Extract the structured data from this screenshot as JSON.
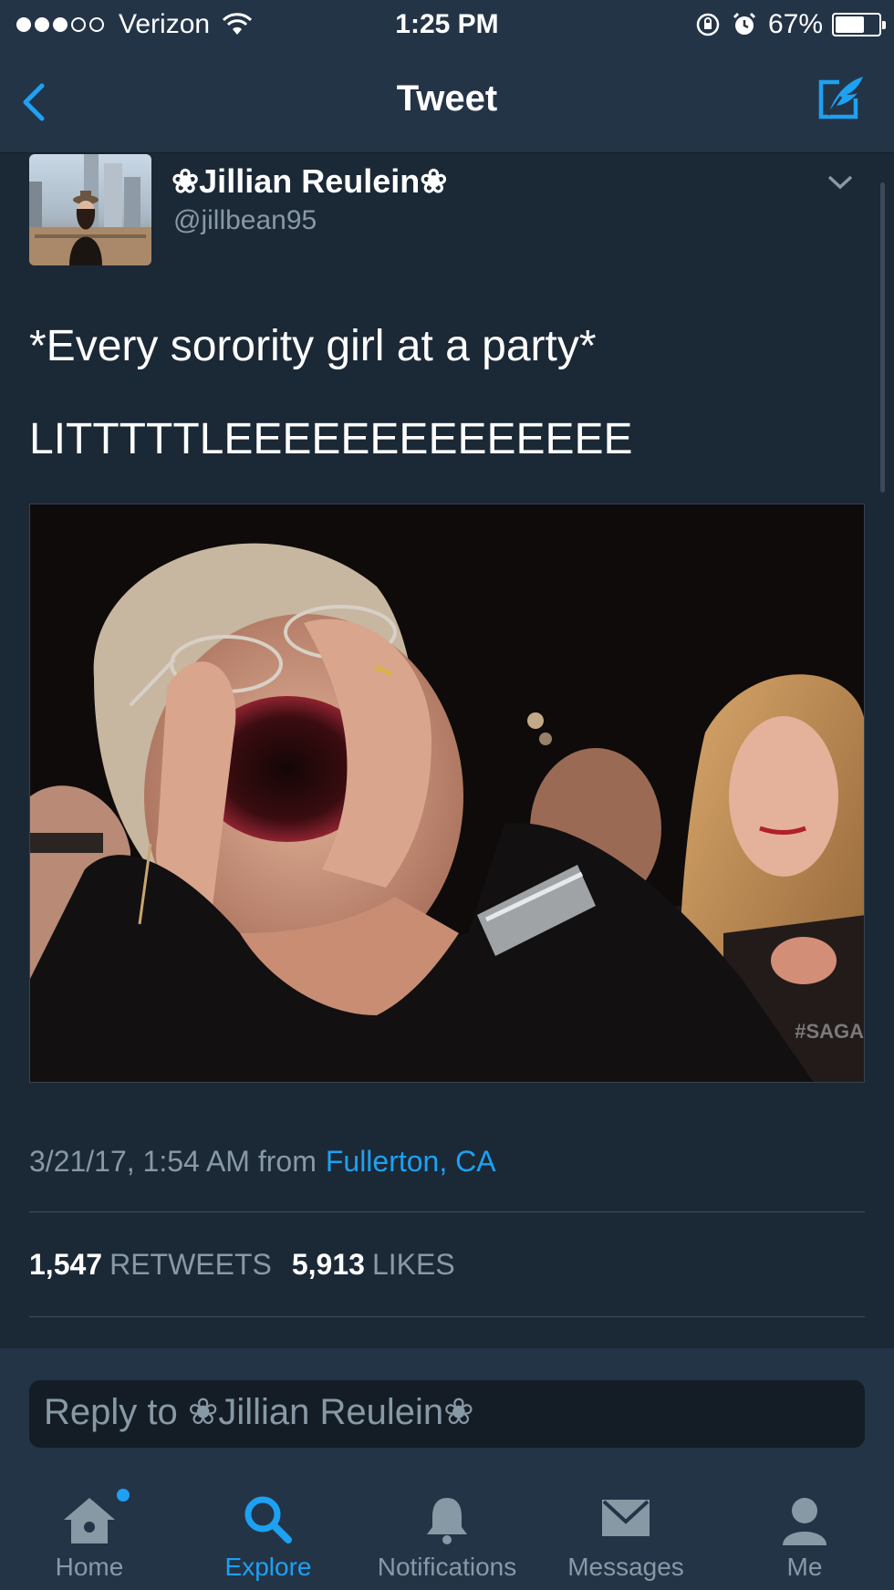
{
  "status_bar": {
    "carrier": "Verizon",
    "time": "1:25 PM",
    "battery": "67%",
    "battery_level": 0.67
  },
  "nav": {
    "title": "Tweet",
    "back_icon": "chevron-left-icon",
    "compose_icon": "compose-tweet-icon"
  },
  "tweet": {
    "display_name": "❀Jillian Reulein❀",
    "handle": "@jillbean95",
    "text_line1": "*Every sorority girl at a party*",
    "text_line2": "LITTTTTLEEEEEEEEEEEEEE",
    "media_watermark": "#SAGA",
    "timestamp": "3/21/17, 1:54 AM from",
    "location": "Fullerton, CA",
    "retweets_count": "1,547",
    "retweets_label": "RETWEETS",
    "likes_count": "5,913",
    "likes_label": "LIKES"
  },
  "reply": {
    "placeholder": "Reply to ❀Jillian Reulein❀"
  },
  "tabs": [
    {
      "label": "Home",
      "icon": "home-icon",
      "active": false,
      "badge": true
    },
    {
      "label": "Explore",
      "icon": "search-icon",
      "active": true
    },
    {
      "label": "Notifications",
      "icon": "bell-icon",
      "active": false
    },
    {
      "label": "Messages",
      "icon": "envelope-icon",
      "active": false
    },
    {
      "label": "Me",
      "icon": "person-icon",
      "active": false
    }
  ],
  "colors": {
    "accent": "#1da1f2",
    "background": "#1b2836",
    "bar": "#243447",
    "secondary_text": "#8899a6"
  }
}
